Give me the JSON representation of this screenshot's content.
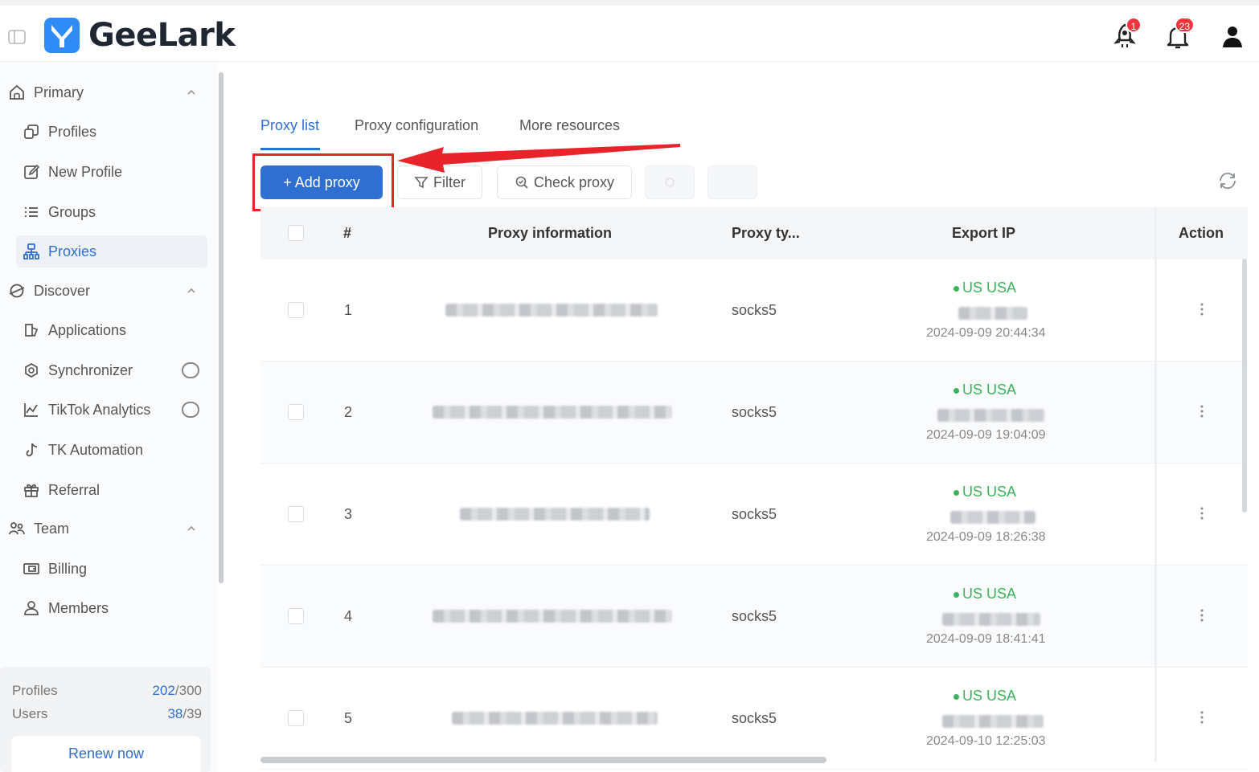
{
  "app": {
    "name": "GeeLark"
  },
  "header": {
    "rocket_badge": "1",
    "bell_badge": "23"
  },
  "sidebar": {
    "groups": [
      {
        "label": "Primary"
      },
      {
        "label": "Discover"
      },
      {
        "label": "Team"
      }
    ],
    "items": [
      {
        "label": "Profiles"
      },
      {
        "label": "New Profile"
      },
      {
        "label": "Groups"
      },
      {
        "label": "Proxies"
      },
      {
        "label": "Applications"
      },
      {
        "label": "Synchronizer"
      },
      {
        "label": "TikTok Analytics"
      },
      {
        "label": "TK Automation"
      },
      {
        "label": "Referral"
      },
      {
        "label": "Billing"
      },
      {
        "label": "Members"
      }
    ],
    "footer": {
      "profiles_label": "Profiles",
      "profiles_used": "202",
      "profiles_total": "/300",
      "users_label": "Users",
      "users_used": "38",
      "users_total": "/39",
      "renew_label": "Renew now"
    }
  },
  "tabs": [
    {
      "label": "Proxy list"
    },
    {
      "label": "Proxy configuration"
    },
    {
      "label": "More resources"
    }
  ],
  "toolbar": {
    "add_label": "+ Add proxy",
    "filter_label": "Filter",
    "check_label": "Check proxy"
  },
  "table": {
    "columns": [
      "#",
      "Proxy information",
      "Proxy ty...",
      "Export IP",
      "Action"
    ],
    "rows": [
      {
        "index": "1",
        "type": "socks5",
        "country": "US USA",
        "time": "2024-09-09 20:44:34"
      },
      {
        "index": "2",
        "type": "socks5",
        "country": "US USA",
        "time": "2024-09-09 19:04:09"
      },
      {
        "index": "3",
        "type": "socks5",
        "country": "US USA",
        "time": "2024-09-09 18:26:38"
      },
      {
        "index": "4",
        "type": "socks5",
        "country": "US USA",
        "time": "2024-09-09 18:41:41"
      },
      {
        "index": "5",
        "type": "socks5",
        "country": "US USA",
        "time": "2024-09-10 12:25:03"
      }
    ]
  },
  "colors": {
    "accent": "#2f6fd1",
    "online": "#3bb35a",
    "highlight": "#e8232a",
    "badge": "#f0353f"
  }
}
